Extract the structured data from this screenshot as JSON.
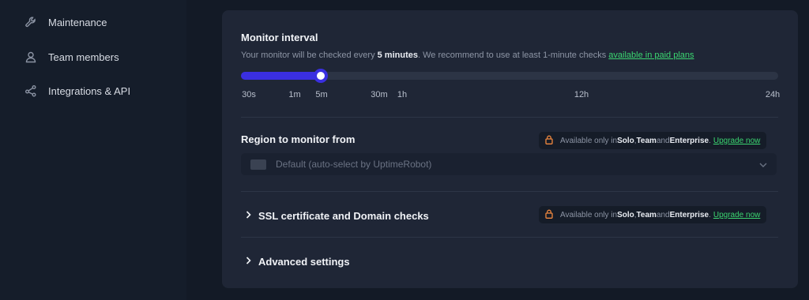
{
  "sidebar": {
    "items": [
      {
        "label": "Maintenance",
        "icon": "wrench-icon"
      },
      {
        "label": "Team members",
        "icon": "user-icon"
      },
      {
        "label": "Integrations & API",
        "icon": "share-icon"
      }
    ]
  },
  "monitor_interval": {
    "title": "Monitor interval",
    "desc_prefix": "Your monitor will be checked every ",
    "desc_bold": "5 minutes",
    "desc_mid": ". We recommend to use at least 1-minute checks ",
    "desc_link": "available in paid plans",
    "slider_value": "5m",
    "ticks": [
      "30s",
      "1m",
      "5m",
      "30m",
      "1h",
      "12h",
      "24h"
    ]
  },
  "region": {
    "title": "Region to monitor from",
    "select_value": "Default (auto-select by UptimeRobot)"
  },
  "ssl": {
    "title": "SSL certificate and Domain checks"
  },
  "advanced": {
    "title": "Advanced settings"
  },
  "upsell": {
    "prefix": "Available only in ",
    "plan1": "Solo",
    "sep": ", ",
    "plan2": "Team",
    "and": " and ",
    "plan3": "Enterprise",
    "dot": ".",
    "upgrade": "Upgrade now"
  },
  "colors": {
    "accent": "#3a2fe0",
    "link": "#3bd671",
    "lock": "#f0883e"
  }
}
